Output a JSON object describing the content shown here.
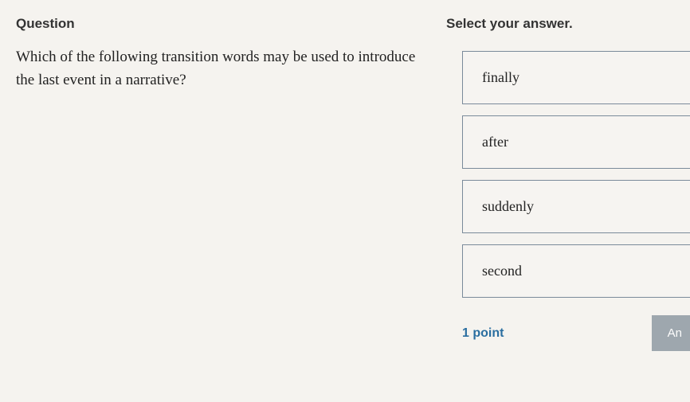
{
  "question": {
    "label": "Question",
    "text": "Which of the following transition words may be used to introduce the last event in a narrative?"
  },
  "answers": {
    "label": "Select your answer.",
    "options": [
      "finally",
      "after",
      "suddenly",
      "second"
    ]
  },
  "footer": {
    "points": "1 point",
    "answer_button": "An"
  }
}
